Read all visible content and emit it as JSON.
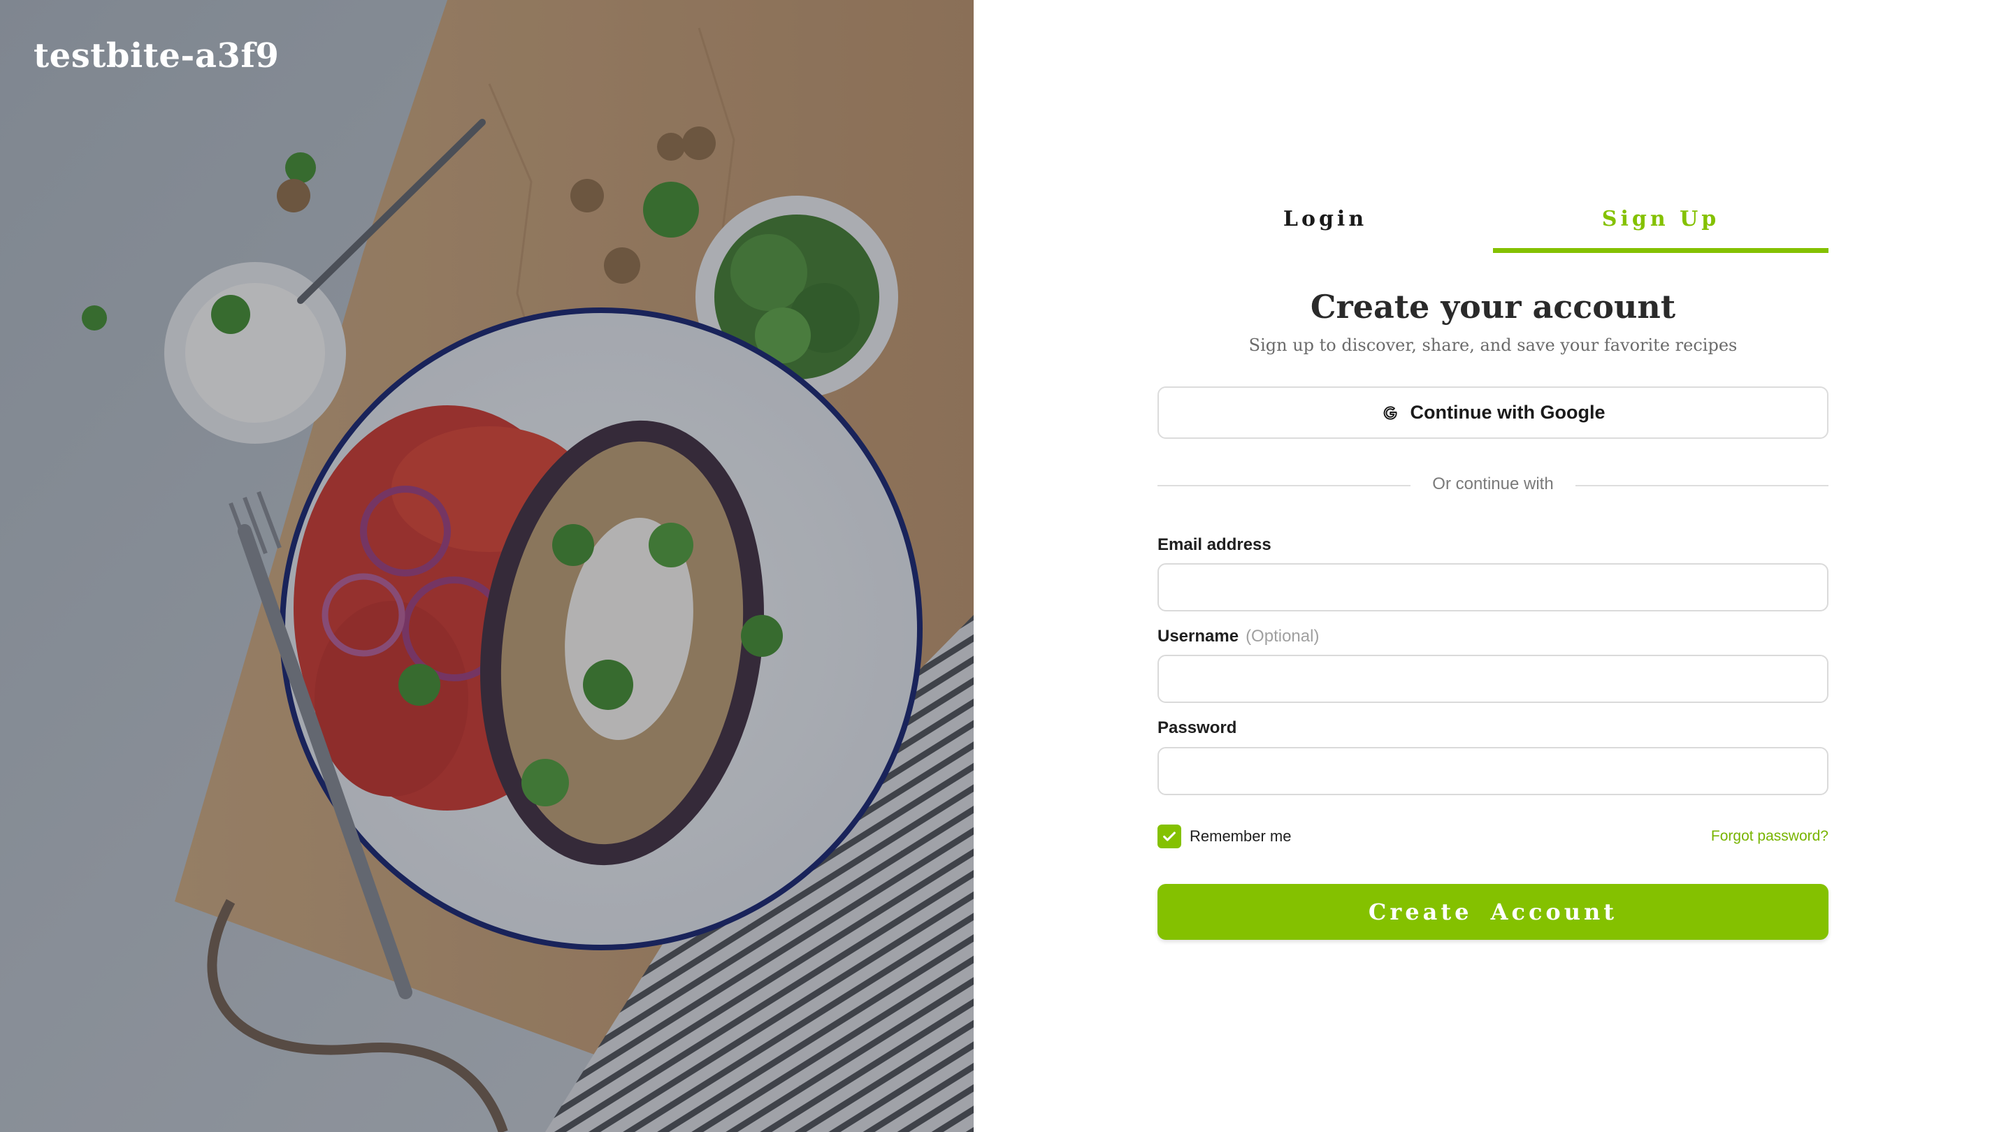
{
  "brand": {
    "name": "testbite-a3f9"
  },
  "tabs": [
    {
      "label": "Login",
      "active": false
    },
    {
      "label": "Sign Up",
      "active": true
    }
  ],
  "heading": {
    "title": "Create your account",
    "subtitle": "Sign up to discover, share, and save your favorite recipes"
  },
  "google": {
    "label": "Continue with Google",
    "icon": "google-g-icon"
  },
  "divider": {
    "text": "Or continue with"
  },
  "fields": {
    "email": {
      "label": "Email address",
      "value": "",
      "placeholder": ""
    },
    "username": {
      "label": "Username",
      "optional": "(Optional)",
      "value": "",
      "placeholder": ""
    },
    "password": {
      "label": "Password",
      "value": "",
      "placeholder": ""
    }
  },
  "remember": {
    "label": "Remember me",
    "checked": true
  },
  "forgot": {
    "label": "Forgot password?"
  },
  "submit": {
    "label": "Create Account"
  },
  "colors": {
    "accent": "#84c100",
    "link": "#78b400",
    "heroOverlay": "rgba(40,45,55,0.32)"
  }
}
